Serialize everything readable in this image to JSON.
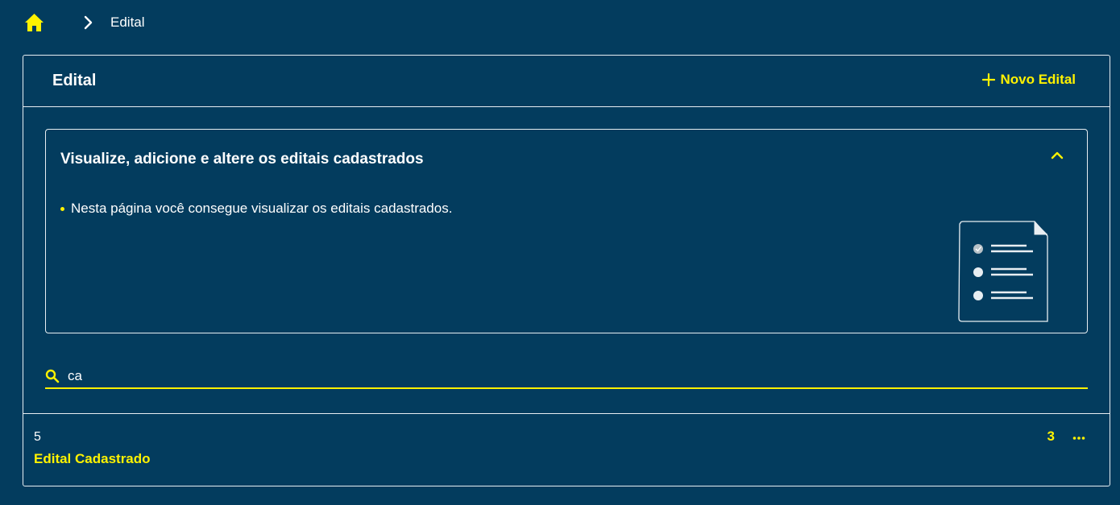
{
  "breadcrumb": {
    "home_icon": "home-icon",
    "separator_icon": "chevron-right-icon",
    "current": "Edital"
  },
  "header": {
    "title": "Edital",
    "new_button_label": "Novo Edital",
    "new_button_icon": "plus-icon"
  },
  "info": {
    "title": "Visualize, adicione e altere os editais cadastrados",
    "bullet": "Nesta página você consegue visualizar os editais cadastrados.",
    "collapse_icon": "chevron-up-icon",
    "illustration": "checklist-document-illustration"
  },
  "search": {
    "icon": "search-icon",
    "value": "ca",
    "placeholder": ""
  },
  "list": {
    "items": [
      {
        "number": "5",
        "title": "Edital Cadastrado",
        "count": "3",
        "menu_icon": "more-horizontal-icon"
      }
    ]
  },
  "colors": {
    "background": "#033c5e",
    "accent": "#fff200",
    "border": "#e8eef2",
    "text": "#ffffff"
  }
}
